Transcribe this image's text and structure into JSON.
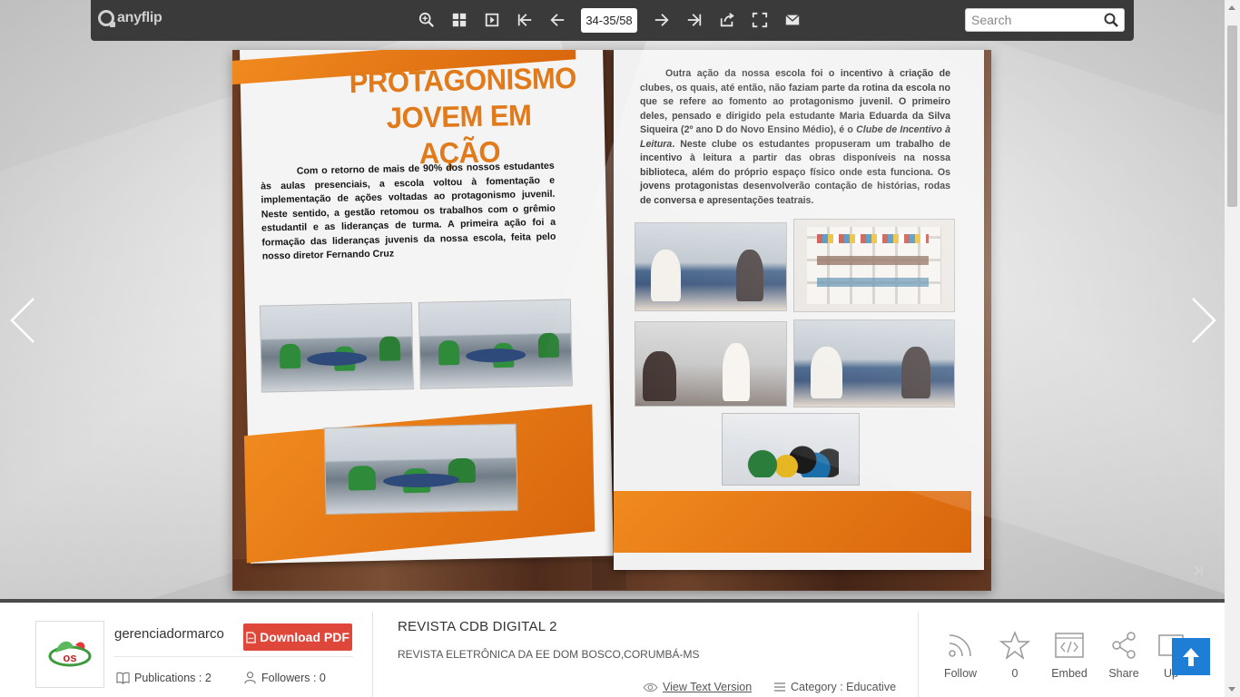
{
  "toolbar": {
    "brand": "anyflip",
    "page_indicator": "34-35/58",
    "search_placeholder": "Search",
    "icons": [
      "zoom-in-icon",
      "thumbnails-icon",
      "single-page-icon",
      "first-page-icon",
      "previous-page-icon",
      "next-page-icon",
      "last-page-icon",
      "share-icon",
      "fullscreen-icon",
      "email-icon"
    ]
  },
  "book": {
    "left_page": {
      "headline_line1": "PROTAGONISMO",
      "headline_line2": "JOVEM EM AÇÃO",
      "paragraph": "Com o retorno de mais de 90% dos nossos estudantes às aulas presenciais, a escola voltou à fomentação e implementação de ações voltadas ao protagonismo juvenil. Neste sentido, a gestão retomou os trabalhos com o grêmio estudantil e as lideranças de turma. A primeira ação foi a formação das lideranças juvenis da nossa escola, feita pelo nosso diretor Fernando Cruz"
    },
    "right_page": {
      "paragraph_before_italic": "Outra ação da nossa escola foi o incentivo à criação de clubes, os quais, até então, não faziam parte da rotina da escola no que se refere ao fomento ao protagonismo juvenil. O primeiro deles, pensado e dirigido pela estudante Maria Eduarda da Silva Siqueira (2º ano D do Novo Ensino Médio), é o ",
      "italic_phrase": "Clube de Incentivo à Leitura",
      "paragraph_after_italic": ". Neste clube os estudantes propuseram um trabalho de incentivo à leitura a partir das obras disponíveis na nossa biblioteca, além do próprio espaço físico onde esta funciona. Os jovens protagonistas desenvolverão contação de histórias, rodas de conversa e apresentações teatrais."
    }
  },
  "publisher": {
    "username": "gerenciadormarco",
    "download_label": "Download PDF",
    "publications_label": "Publications : 2",
    "followers_label": "Followers : 0"
  },
  "document": {
    "title": "REVISTA CDB DIGITAL 2",
    "description": "REVISTA ELETRÔNICA DA EE DOM BOSCO,CORUMBÁ-MS",
    "view_text_label": "View Text Version",
    "category_label": "Category : Educative"
  },
  "actions": {
    "follow_label": "Follow",
    "star_count": "0",
    "embed_label": "Embed",
    "share_label": "Share",
    "upload_label": "Up"
  },
  "colors": {
    "toolbar_bg": "#3a3a3a",
    "orange_accent": "#e8781a",
    "download_btn": "#e0473b",
    "up_btn": "#1e7ed6"
  }
}
